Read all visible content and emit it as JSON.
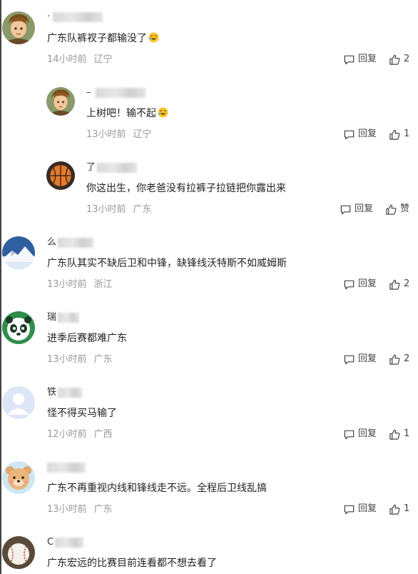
{
  "comments": [
    {
      "name_visible": "·",
      "text": "广东队裤衩子都输没了",
      "emoji": "rofl",
      "time": "14小时前",
      "location": "辽宁",
      "reply": "回复",
      "likes": "2"
    },
    {
      "name_visible": "–",
      "text": "上树吧！输不起",
      "emoji": "rofl",
      "time": "13小时前",
      "location": "辽宁",
      "reply": "回复",
      "likes": "1"
    },
    {
      "name_visible": "了",
      "text": "你这出生，你老爸没有拉裤子拉链把你露出来",
      "emoji": "",
      "time": "13小时前",
      "location": "广东",
      "reply": "回复",
      "likes": "赞"
    },
    {
      "name_visible": "么",
      "text": "广东队其实不缺后卫和中锋，缺锋线沃特斯不如威姆斯",
      "emoji": "",
      "time": "13小时前",
      "location": "浙江",
      "reply": "回复",
      "likes": "2"
    },
    {
      "name_visible": "瑞",
      "text": "进季后赛都难广东",
      "emoji": "",
      "time": "13小时前",
      "location": "广东",
      "reply": "回复",
      "likes": "2"
    },
    {
      "name_visible": "铁",
      "text": "怪不得买马输了",
      "emoji": "",
      "time": "12小时前",
      "location": "广西",
      "reply": "回复",
      "likes": "1"
    },
    {
      "name_visible": "",
      "text": "广东不再重视内线和锋线走不远。全程后卫线乱搞",
      "emoji": "",
      "time": "13小时前",
      "location": "广东",
      "reply": "回复",
      "likes": "1"
    },
    {
      "name_visible": "C",
      "text": "广东宏远的比赛目前连看都不想去看了",
      "emoji": "",
      "time": "",
      "location": "",
      "reply": "",
      "likes": ""
    }
  ],
  "icons": {
    "reply": "comment-bubble-icon",
    "like": "thumbs-up-icon"
  }
}
